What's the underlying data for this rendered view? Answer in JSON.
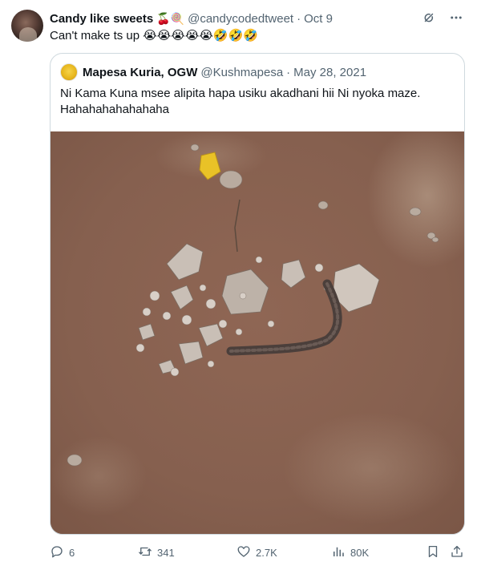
{
  "tweet": {
    "author_name": "Candy like sweets",
    "author_emojis": "🍒🍭",
    "handle": "@candycodedtweet",
    "separator": "·",
    "date": "Oct 9",
    "text": "Can't make ts up 😭😭😭😭😭🤣🤣🤣"
  },
  "quoted": {
    "author_name": "Mapesa Kuria, OGW",
    "handle": "@Kushmapesa",
    "separator": "·",
    "date": "May 28, 2021",
    "text_line1": "Ni Kama Kuna msee alipita hapa usiku akadhani hii Ni nyoka maze.",
    "text_line2": "Hahahahahahahaha"
  },
  "actions": {
    "replies": "6",
    "reposts": "341",
    "likes": "2.7K",
    "views": "80K"
  },
  "icons": {
    "grok": "grok-icon",
    "more": "more-icon",
    "reply": "reply-icon",
    "repost": "repost-icon",
    "like": "like-icon",
    "views": "views-icon",
    "bookmark": "bookmark-icon",
    "share": "share-icon"
  },
  "colors": {
    "text_primary": "#0f1419",
    "text_secondary": "#536471",
    "border": "#cfd9de",
    "ground": "#8a6150"
  }
}
